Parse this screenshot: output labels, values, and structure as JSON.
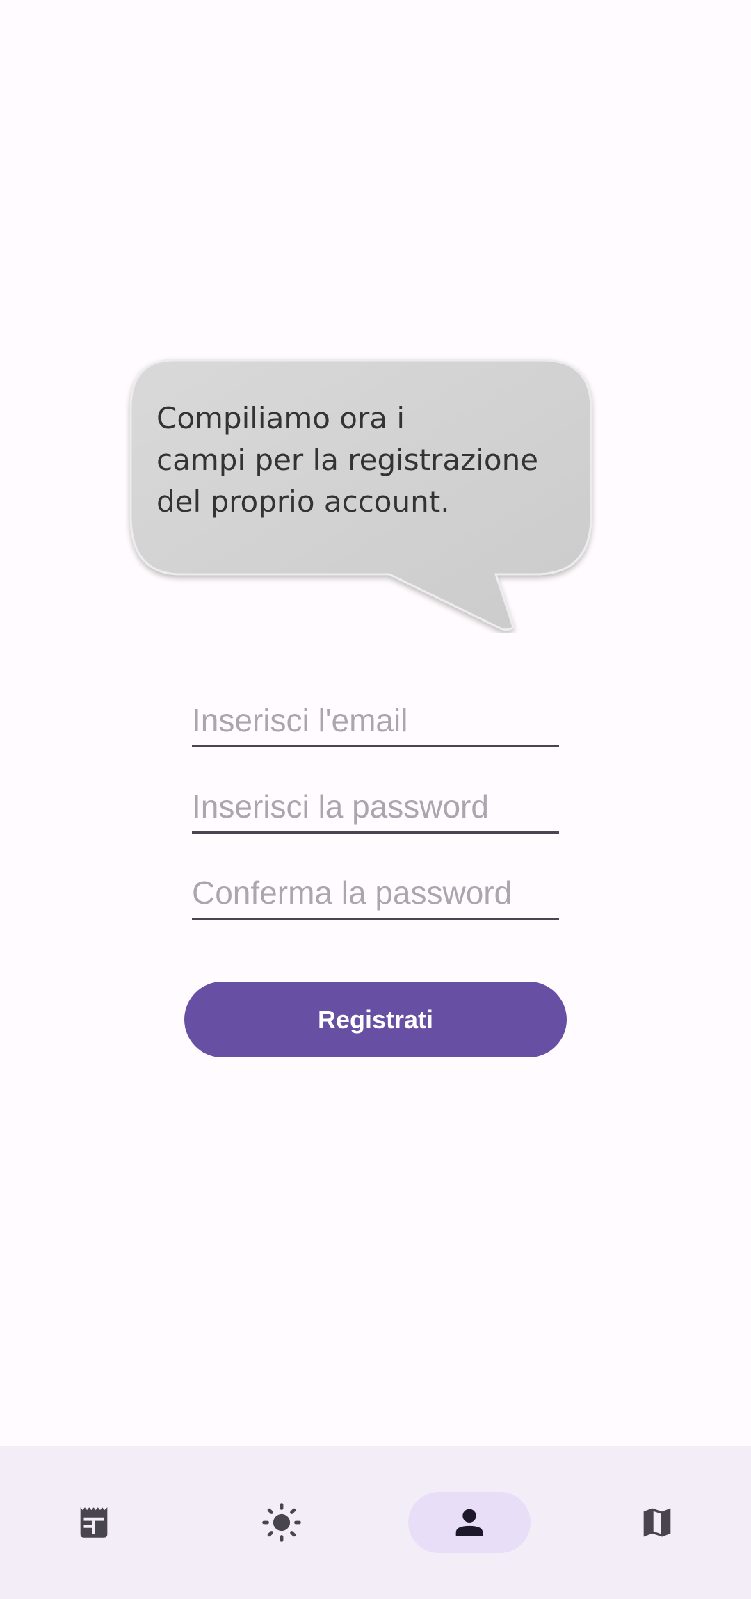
{
  "bubble": {
    "text": "Compiliamo ora i\ncampi per la registrazione\ndel proprio account."
  },
  "form": {
    "email_placeholder": "Inserisci l'email",
    "email_value": "",
    "password_placeholder": "Inserisci la password",
    "password_value": "",
    "confirm_placeholder": "Conferma la password",
    "confirm_value": "",
    "submit_label": "Registrati"
  },
  "nav": {
    "items": [
      {
        "icon": "newspaper-icon",
        "active": false
      },
      {
        "icon": "sun-icon",
        "active": false
      },
      {
        "icon": "person-icon",
        "active": true
      },
      {
        "icon": "map-icon",
        "active": false
      }
    ]
  },
  "colors": {
    "primary": "#6750a4",
    "background": "#fffbfe",
    "nav_background": "#f3edf7",
    "nav_active_indicator": "#e8def8",
    "bubble_fill": "#d3d3d3"
  }
}
